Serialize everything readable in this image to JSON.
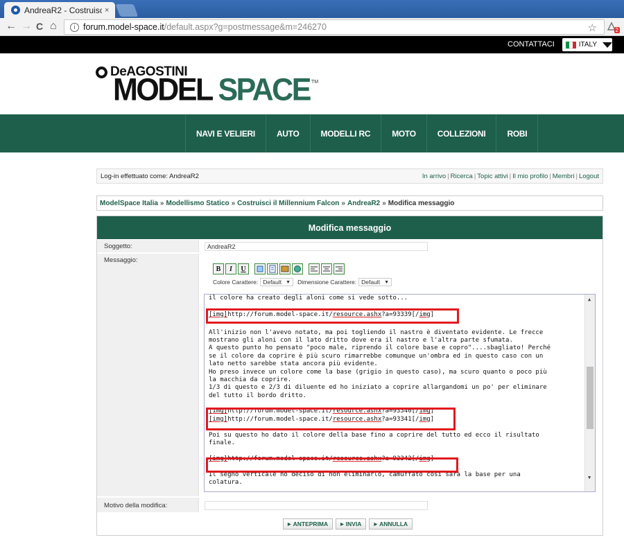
{
  "browser": {
    "tab_title": "AndreaR2 - Costruisci il M",
    "tab_close": "×",
    "url_host": "forum.model-space.it",
    "url_path": "/default.aspx?g=postmessage&m=246270",
    "url_info": "i",
    "back": "←",
    "forward": "→",
    "reload": "C",
    "home": "⌂",
    "star": "☆",
    "ext_badge": "2"
  },
  "topbar": {
    "contact": "CONTATTACI",
    "country": "ITALY",
    "flag_colors": [
      "#009246",
      "#ffffff",
      "#ce2b37"
    ]
  },
  "logo": {
    "brand": "DeAGOSTINI",
    "main1": "MODEL",
    "main2": " SPACE",
    "tm": "TM"
  },
  "menu": {
    "items": [
      "NAVI E VELIERI",
      "AUTO",
      "MODELLI RC",
      "MOTO",
      "COLLEZIONI",
      "ROBI"
    ]
  },
  "login": {
    "text": "Log-in effettuato come: AndreaR2",
    "links": [
      "In arrivo",
      "Ricerca",
      "Topic attivi",
      "Il mio profilo",
      "Membri",
      "Logout"
    ],
    "separator": "|"
  },
  "breadcrumb": {
    "items": [
      "ModelSpace Italia",
      "Modellismo Statico",
      "Costruisci il Millennium Falcon",
      "AndreaR2"
    ],
    "current": "Modifica messaggio",
    "separator": "»"
  },
  "form": {
    "title": "Modifica messaggio",
    "subject_label": "Soggetto:",
    "subject_value": "AndreaR2",
    "message_label": "Messaggio:",
    "reason_label": "Motivo della modifica:",
    "reason_value": "",
    "editor_buttons": [
      "B",
      "I",
      "U",
      "img",
      "list",
      "pic",
      "globe",
      "left",
      "center",
      "right"
    ],
    "color_label": "Colore Carattere:",
    "color_value": "Default",
    "size_label": "Dimensione Carattere:",
    "size_value": "Default",
    "select_arrow": "▼",
    "scroll_up": "▲",
    "scroll_down": "▼"
  },
  "message": {
    "l01": "il colore ha creato degli aloni come si vede sotto...",
    "img1_a": "[img]",
    "img1_b": "http://forum.model-space.it/",
    "img1_c": "resource.ashx",
    "img1_d": "?a=93339[/",
    "img1_e": "img",
    "img1_f": "]",
    "p1": "All'inizio non l'avevo notato, ma poi togliendo il nastro è diventato evidente. Le frecce",
    "p2": "mostrano gli aloni con il lato dritto dove era il nastro e l'altra parte sfumata.",
    "p3": "A questo punto ho pensato \"poco male, riprendo il colore base e copro\"....sbagliato! Perché",
    "p4": "se il colore da coprire è più scuro rimarrebbe comunque un'ombra ed in questo caso con un",
    "p5": "lato netto sarebbe stata ancora più evidente.",
    "p6": "Ho preso invece un colore come la base (grigio in questo caso), ma scuro quanto o poco più",
    "p7": "la macchia da coprire.",
    "p8": "1/3 di questo e 2/3 di diluente ed ho iniziato a coprire allargandomi un po' per eliminare",
    "p9": "del tutto il bordo dritto.",
    "img2_d": "?a=93340[/",
    "img3_d": "?a=93341[/",
    "q1": "Poi su questo ho dato il colore della base fino a coprire del tutto ed ecco il risultato",
    "q2": "finale.",
    "img4_d": "?a=93342[/",
    "r1": "Il segno verticale ho deciso di non eliminarlo, camuffato così sarà la base per una",
    "r2": "colatura."
  },
  "actions": {
    "preview": "ANTEPRIMA",
    "send": "INVIA",
    "cancel": "ANNULLA",
    "arrow": "▶"
  },
  "colors": {
    "brand_green": "#1e5f4b",
    "highlight_red": "#e0191e"
  }
}
